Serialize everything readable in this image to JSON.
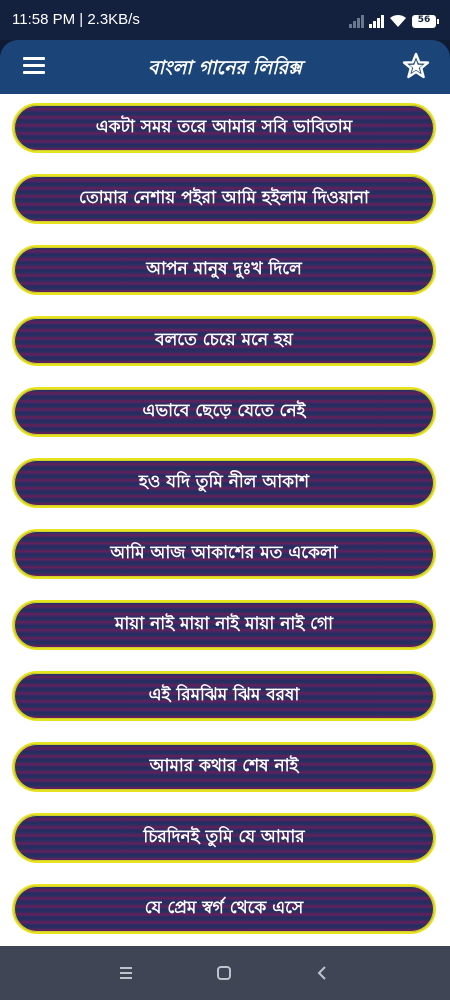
{
  "status_bar": {
    "time_speed": "11:58 PM | 2.3KB/s",
    "battery_level": "56",
    "icons": [
      "signal-icon",
      "signal-icon",
      "wifi-icon",
      "battery-icon"
    ]
  },
  "app_bar": {
    "title": "বাংলা গানের লিরিক্স",
    "menu_icon": "menu-icon",
    "favorite_icon": "star-icon"
  },
  "songs": [
    "একটা সময় তরে আমার সবি ভাবিতাম",
    "তোমার নেশায় পইরা আমি হইলাম দিওয়ানা",
    "আপন মানুষ দুঃখ দিলে",
    "বলতে চেয়ে মনে হয়",
    "এভাবে ছেড়ে যেতে নেই",
    "হও যদি তুমি নীল আকাশ",
    "আমি আজ আকাশের মত একেলা",
    "মায়া নাই মায়া নাই মায়া নাই গো",
    "এই রিমঝিম ঝিম বরষা",
    "আমার কথার শেষ নাই",
    "চিরদিনই তুমি যে আমার",
    "যে প্রেম স্বর্গ থেকে এসে"
  ],
  "nav_bar": {
    "icons": [
      "recents-icon",
      "home-icon",
      "back-icon"
    ]
  },
  "colors": {
    "app_bar": "#1b4478",
    "item_border": "#e7e41f",
    "item_fill_a": "#25305e",
    "item_fill_b": "#6a1e57",
    "nav_bar": "#3f4555"
  }
}
